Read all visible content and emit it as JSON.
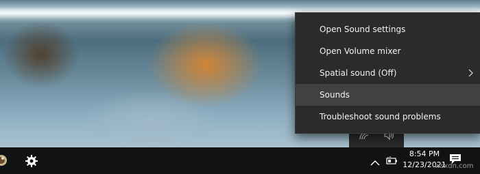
{
  "context_menu": {
    "items": [
      {
        "label": "Open Sound settings"
      },
      {
        "label": "Open Volume mixer"
      },
      {
        "label": "Spatial sound (Off)",
        "submenu": true
      },
      {
        "label": "Sounds",
        "highlighted": true
      },
      {
        "label": "Troubleshoot sound problems"
      }
    ]
  },
  "taskbar": {
    "time": "8:54 PM",
    "date": "12/23/2021"
  },
  "icons": {
    "tray_popout": [
      "network-icon",
      "speaker-icon"
    ],
    "taskbar_left": [
      "app-icon",
      "settings-gear-icon"
    ],
    "taskbar_right": [
      "chevron-up-icon",
      "battery-icon",
      "notification-icon"
    ]
  },
  "watermark": "wsxdn.com",
  "colors": {
    "menu_bg": "#2b2b2b",
    "menu_hover": "#414141",
    "taskbar_bg": "#111214",
    "text": "#f2f2f2"
  }
}
